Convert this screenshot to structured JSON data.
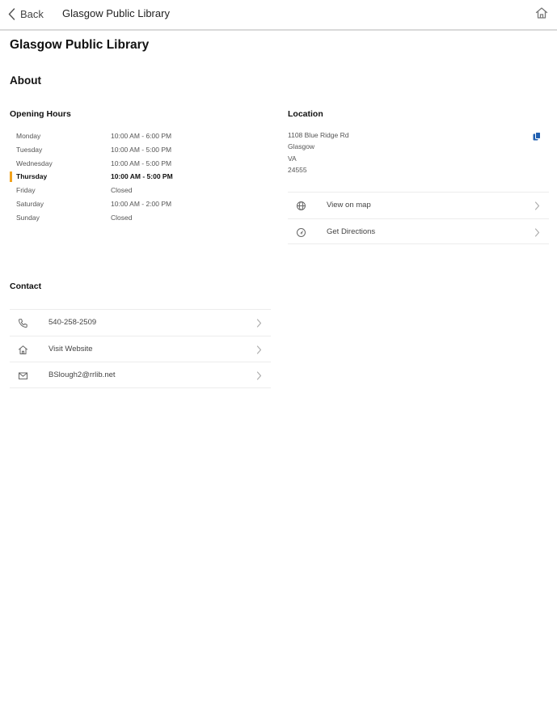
{
  "navbar": {
    "back_label": "Back",
    "title": "Glasgow Public Library",
    "home_icon": "home-icon"
  },
  "page": {
    "title": "Glasgow Public Library",
    "about_heading": "About"
  },
  "opening_hours": {
    "heading": "Opening Hours",
    "rows": [
      {
        "day": "Monday",
        "time": "10:00 AM - 6:00 PM",
        "today": false
      },
      {
        "day": "Tuesday",
        "time": "10:00 AM - 5:00 PM",
        "today": false
      },
      {
        "day": "Wednesday",
        "time": "10:00 AM - 5:00 PM",
        "today": false
      },
      {
        "day": "Thursday",
        "time": "10:00 AM - 5:00 PM",
        "today": true
      },
      {
        "day": "Friday",
        "time": "Closed",
        "today": false
      },
      {
        "day": "Saturday",
        "time": "10:00 AM - 2:00 PM",
        "today": false
      },
      {
        "day": "Sunday",
        "time": "Closed",
        "today": false
      }
    ],
    "today_marker_color": "#f2a21c"
  },
  "location": {
    "heading": "Location",
    "address_lines": [
      "1108 Blue Ridge Rd",
      "Glasgow",
      "VA",
      "24555"
    ],
    "copy_icon": "copy-icon",
    "copy_icon_color": "#1f5fb0",
    "actions": [
      {
        "label": "View on map",
        "icon": "globe-icon"
      },
      {
        "label": "Get Directions",
        "icon": "directions-icon"
      }
    ]
  },
  "contact": {
    "heading": "Contact",
    "items": [
      {
        "label": "540-258-2509",
        "icon": "phone-icon"
      },
      {
        "label": "Visit Website",
        "icon": "home-icon"
      },
      {
        "label": "BSlough2@rrlib.net",
        "icon": "mail-icon"
      }
    ]
  }
}
